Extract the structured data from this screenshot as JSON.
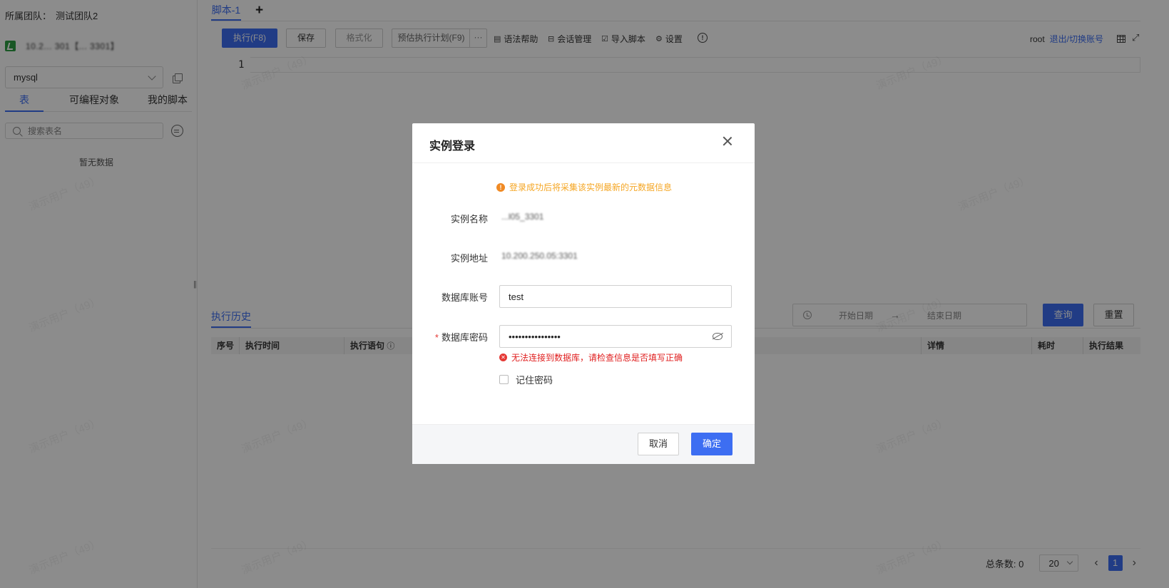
{
  "sidebar": {
    "team_label": "所属团队：",
    "team_value": "测试团队2",
    "instance_text": "10.2... 301【... 3301】",
    "db_type": "mysql",
    "tabs": [
      {
        "label": "表"
      },
      {
        "label": "可编程对象"
      },
      {
        "label": "我的脚本"
      }
    ],
    "search_placeholder": "搜索表名",
    "empty_text": "暂无数据"
  },
  "editor": {
    "tab_label": "脚本-1",
    "add_tab": "+",
    "line_number": "1",
    "toolbar": {
      "execute": "执行(F8)",
      "save": "保存",
      "format": "格式化",
      "plan": "预估执行计划(F9)",
      "more": "···",
      "syntax_help": "语法帮助",
      "session_mgmt": "会话管理",
      "import_script": "导入脚本",
      "settings": "设置",
      "info": "!"
    },
    "user": "root",
    "switch_account": "退出/切换账号"
  },
  "history": {
    "tab_label": "执行历史",
    "start_date": "开始日期",
    "end_date": "结束日期",
    "date_arrow": "→",
    "query_button": "查询",
    "reset_button": "重置",
    "columns": [
      {
        "label": "序号"
      },
      {
        "label": "执行时间"
      },
      {
        "label": "执行语句"
      },
      {
        "label": "详情"
      },
      {
        "label": "耗时"
      },
      {
        "label": "执行结果"
      }
    ],
    "total_label": "总条数:",
    "total_value": "0",
    "page_size": "20",
    "current_page": "1"
  },
  "watermark": "演示用户（49）",
  "modal": {
    "title": "实例登录",
    "notice": "登录成功后将采集该实例最新的元数据信息",
    "fields": {
      "name_label": "实例名称",
      "name_value": "...l05_3301",
      "address_label": "实例地址",
      "address_value": "10.200.250.05:3301",
      "account_label": "数据库账号",
      "account_value": "test",
      "password_label": "数据库密码",
      "password_required": "*",
      "password_value": "••••••••••••••••"
    },
    "error_text": "无法连接到数据库，请检查信息是否填写正确",
    "remember_label": "记住密码",
    "cancel_button": "取消",
    "ok_button": "确定"
  },
  "colors": {
    "accent": "#3d6ef2",
    "warning": "#f5a623",
    "error": "#e02020"
  }
}
